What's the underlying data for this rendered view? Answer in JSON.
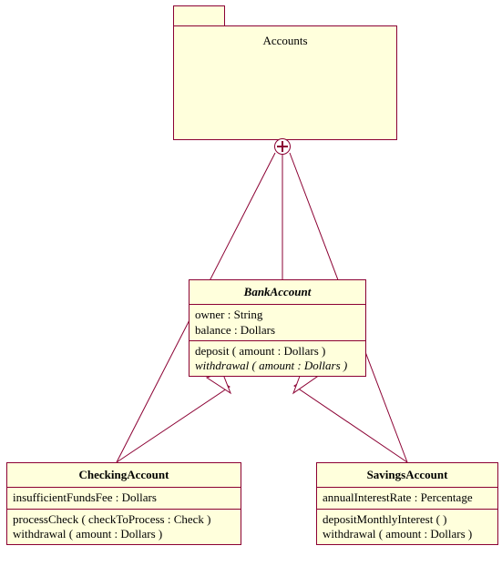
{
  "package": {
    "name": "Accounts"
  },
  "classes": {
    "bank": {
      "name": "BankAccount",
      "attributes": [
        "owner : String",
        "balance : Dollars"
      ],
      "operations_plain": "deposit ( amount : Dollars )",
      "operations_italic": "withdrawal ( amount : Dollars )"
    },
    "checking": {
      "name": "CheckingAccount",
      "attributes": "insufficientFundsFee : Dollars",
      "operations": [
        "processCheck ( checkToProcess : Check )",
        "withdrawal ( amount : Dollars )"
      ]
    },
    "savings": {
      "name": "SavingsAccount",
      "attributes": "annualInterestRate : Percentage",
      "operations": [
        "depositMonthlyInterest (  )",
        "withdrawal ( amount : Dollars )"
      ]
    }
  }
}
